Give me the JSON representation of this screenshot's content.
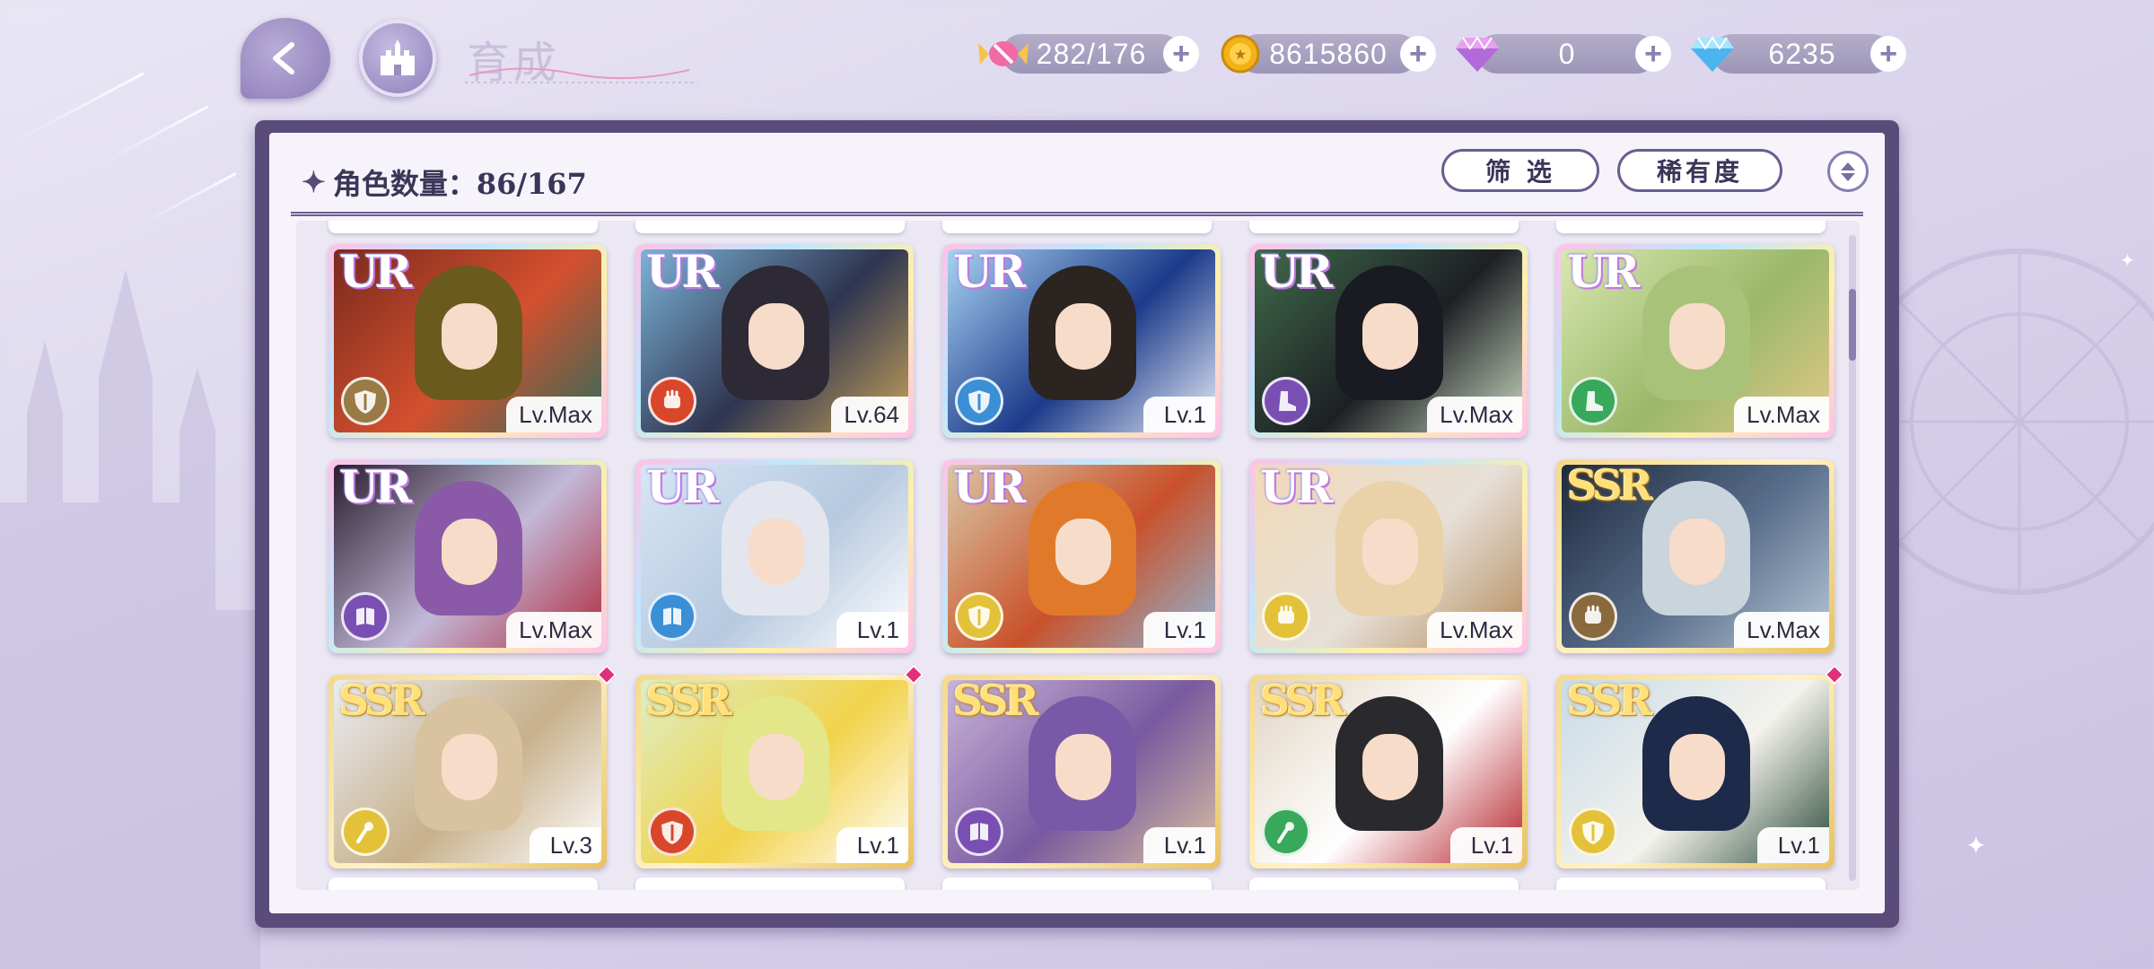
{
  "header": {
    "title": "育成",
    "resources": [
      {
        "name": "stamina",
        "icon": "candy-icon",
        "value": "282/176"
      },
      {
        "name": "gold",
        "icon": "gold-coin-icon",
        "value": "8615860"
      },
      {
        "name": "premium-gem",
        "icon": "pink-diamond-icon",
        "value": "0"
      },
      {
        "name": "diamond",
        "icon": "blue-diamond-icon",
        "value": "6235"
      }
    ]
  },
  "panel": {
    "count_label": "角色数量：86/167",
    "filter_label": "筛 选",
    "sort_label": "稀有度"
  },
  "colors": {
    "attack": "#d9472b",
    "defense_gold": "#e3c23a",
    "defense_blue": "#3b8fd6",
    "defense_brown": "#8a6a3c",
    "magic": "#7a4fb3",
    "heal": "#38a85a"
  },
  "cards": [
    {
      "rarity": "UR",
      "level": "Lv.Max",
      "class_icon": "shield-icon",
      "class_color": "#9a7a45",
      "art": [
        "#7a2a1e",
        "#d4502e",
        "#2f6b5a"
      ],
      "hair": "#6b5a1e",
      "new": false
    },
    {
      "rarity": "UR",
      "level": "Lv.64",
      "class_icon": "fist-icon",
      "class_color": "#d9472b",
      "art": [
        "#7cb4d8",
        "#2f3550",
        "#c7a35a"
      ],
      "hair": "#2d2a35",
      "new": false
    },
    {
      "rarity": "UR",
      "level": "Lv.1",
      "class_icon": "shield-icon",
      "class_color": "#3b8fd6",
      "art": [
        "#a8d4f2",
        "#1c3a8a",
        "#e7eef8"
      ],
      "hair": "#2b2420",
      "new": false
    },
    {
      "rarity": "UR",
      "level": "Lv.Max",
      "class_icon": "boot-icon",
      "class_color": "#7a4fb3",
      "art": [
        "#3e6b4a",
        "#1d1f24",
        "#c9d9c0"
      ],
      "hair": "#1a1a22",
      "new": false
    },
    {
      "rarity": "UR",
      "level": "Lv.Max",
      "class_icon": "boot-icon",
      "class_color": "#38a85a",
      "art": [
        "#d9e7b0",
        "#9ab86a",
        "#e2c88a"
      ],
      "hair": "#a9c27a",
      "new": false
    },
    {
      "rarity": "UR",
      "level": "Lv.Max",
      "class_icon": "book-icon",
      "class_color": "#7a4fb3",
      "art": [
        "#2a1e2e",
        "#c2b8d8",
        "#b02a3c"
      ],
      "hair": "#8a5aa8",
      "new": false
    },
    {
      "rarity": "UR",
      "level": "Lv.1",
      "class_icon": "book-icon",
      "class_color": "#3b8fd6",
      "art": [
        "#d6e6f4",
        "#b7c9e0",
        "#ffffff"
      ],
      "hair": "#e3e6ef",
      "new": false
    },
    {
      "rarity": "UR",
      "level": "Lv.1",
      "class_icon": "shield-icon",
      "class_color": "#e3c23a",
      "art": [
        "#d9c7a6",
        "#c9512a",
        "#8fb6d6"
      ],
      "hair": "#e07a2a",
      "new": false
    },
    {
      "rarity": "UR",
      "level": "Lv.Max",
      "class_icon": "fist-icon",
      "class_color": "#e3c23a",
      "art": [
        "#f2d9b8",
        "#e6e0d8",
        "#b58a5a"
      ],
      "hair": "#e9d2a8",
      "new": false
    },
    {
      "rarity": "SSR",
      "level": "Lv.Max",
      "class_icon": "fist-icon",
      "class_color": "#8a6a3c",
      "art": [
        "#1e2a3e",
        "#5a6f8c",
        "#b8c8d8"
      ],
      "hair": "#c9d4dc",
      "new": false
    },
    {
      "rarity": "SSR",
      "level": "Lv.3",
      "class_icon": "staff-icon",
      "class_color": "#e3c23a",
      "art": [
        "#e9ecf2",
        "#c7b08a",
        "#ffffff"
      ],
      "hair": "#d9c2a0",
      "new": true
    },
    {
      "rarity": "SSR",
      "level": "Lv.1",
      "class_icon": "shield-icon",
      "class_color": "#d9472b",
      "art": [
        "#dcefc4",
        "#f2d24a",
        "#ffffff"
      ],
      "hair": "#e4e68a",
      "new": true
    },
    {
      "rarity": "SSR",
      "level": "Lv.1",
      "class_icon": "book-icon",
      "class_color": "#7a4fb3",
      "art": [
        "#c9b4d8",
        "#7a5aa0",
        "#d8c0a0"
      ],
      "hair": "#7a58a8",
      "new": false
    },
    {
      "rarity": "SSR",
      "level": "Lv.1",
      "class_icon": "staff-icon",
      "class_color": "#38a85a",
      "art": [
        "#e2d6c4",
        "#ffffff",
        "#b5222a"
      ],
      "hair": "#2a2a2e",
      "new": false
    },
    {
      "rarity": "SSR",
      "level": "Lv.1",
      "class_icon": "shield-icon",
      "class_color": "#e3c23a",
      "art": [
        "#c9dbe8",
        "#f4f2ec",
        "#2b4a3a"
      ],
      "hair": "#1e2a4a",
      "new": true
    }
  ]
}
